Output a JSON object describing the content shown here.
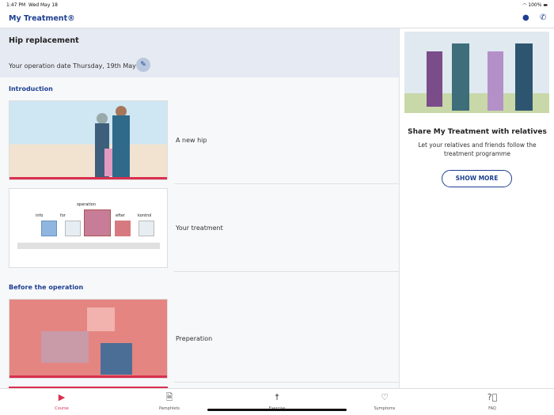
{
  "status": {
    "time": "1:47 PM",
    "date": "Wed May 18",
    "battery": "100%"
  },
  "app": {
    "title": "My Treatment®"
  },
  "header": {
    "title": "Hip replacement",
    "operation_date": "Your operation date Thursday, 19th May"
  },
  "sections": [
    {
      "title": "Introduction",
      "items": [
        {
          "label": "A new hip"
        },
        {
          "label": "Your treatment",
          "steps": [
            "info",
            "for",
            "operation",
            "efter",
            "kontrol"
          ]
        }
      ]
    },
    {
      "title": "Before the operation",
      "items": [
        {
          "label": "Preperation"
        }
      ]
    }
  ],
  "share": {
    "title": "Share My Treatment with relatives",
    "text": "Let your relatives and friends follow the treatment programme",
    "button": "SHOW MORE"
  },
  "tabs": [
    {
      "label": "Course",
      "icon": "play-circle-icon"
    },
    {
      "label": "Pamphlets",
      "icon": "document-icon"
    },
    {
      "label": "Exercise",
      "icon": "exercise-figure-icon"
    },
    {
      "label": "Symptoms",
      "icon": "heart-icon"
    },
    {
      "label": "FAQ",
      "icon": "question-circle-icon"
    }
  ],
  "colors": {
    "brand": "#1d3f8f",
    "accent": "#d9304f"
  }
}
